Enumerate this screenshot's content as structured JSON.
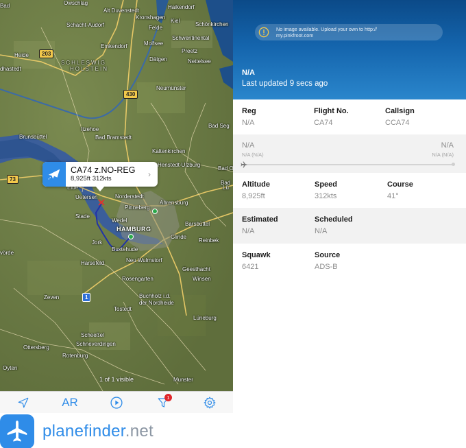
{
  "map": {
    "places": [
      {
        "id": "owschlag",
        "name": "Owschlag"
      },
      {
        "id": "alt-duvenstedt",
        "name": "Alt Duvenstedt"
      },
      {
        "id": "haikendorf",
        "name": "Haikendorf"
      },
      {
        "id": "kronshagen",
        "name": "Kronshagen"
      },
      {
        "id": "schacht-audorf",
        "name": "Schacht-Audorf"
      },
      {
        "id": "felde",
        "name": "Felde"
      },
      {
        "id": "kiel",
        "name": "Kiel"
      },
      {
        "id": "schonkirchen",
        "name": "Schönkirchen"
      },
      {
        "id": "schwentinental",
        "name": "Schwentinental"
      },
      {
        "id": "emkendorf",
        "name": "Emkendorf"
      },
      {
        "id": "molfsee",
        "name": "Molfsee"
      },
      {
        "id": "preetz",
        "name": "Preetz"
      },
      {
        "id": "heide",
        "name": "Heide"
      },
      {
        "id": "dahstedt",
        "name": "dhastedt"
      },
      {
        "id": "datgen",
        "name": "Dätgen"
      },
      {
        "id": "nettelsee",
        "name": "Nettelsee"
      },
      {
        "id": "neumunster",
        "name": "Neumünster"
      },
      {
        "id": "itzehoe",
        "name": "Itzehoe"
      },
      {
        "id": "bad-segeberg",
        "name": "Bad Seg"
      },
      {
        "id": "brunsbuttel",
        "name": "Brunsbüttel"
      },
      {
        "id": "bad-bramstedt",
        "name": "Bad Bramstedt"
      },
      {
        "id": "kaltenkirchen",
        "name": "Kaltenkirchen"
      },
      {
        "id": "henstedt-ulzburg",
        "name": "Henstedt-Ulzburg"
      },
      {
        "id": "bad-o",
        "name": "Bad O"
      },
      {
        "id": "uetersen",
        "name": "Uetersen"
      },
      {
        "id": "norderstedt",
        "name": "Norderstedt"
      },
      {
        "id": "ahrensburg",
        "name": "Ahrensburg"
      },
      {
        "id": "pinneberg",
        "name": "Pinneberg"
      },
      {
        "id": "stade",
        "name": "Stade"
      },
      {
        "id": "wedel",
        "name": "Wedel"
      },
      {
        "id": "hamburg",
        "name": "HAMBURG"
      },
      {
        "id": "barsbuttel",
        "name": "Barsbüttel"
      },
      {
        "id": "glinde",
        "name": "Glinde"
      },
      {
        "id": "reinbek",
        "name": "Reinbek"
      },
      {
        "id": "jork",
        "name": "Jork"
      },
      {
        "id": "buxtehude",
        "name": "Buxtehude"
      },
      {
        "id": "neu-wulmstorf",
        "name": "Neu Wulmstorf"
      },
      {
        "id": "harsefeld",
        "name": "Harsefeld"
      },
      {
        "id": "geesthacht",
        "name": "Geesthacht"
      },
      {
        "id": "rosengarten",
        "name": "Rosengarten"
      },
      {
        "id": "winsen",
        "name": "Winsen"
      },
      {
        "id": "zeven",
        "name": "Zeven"
      },
      {
        "id": "buchholz",
        "name": "Buchholz i.d."
      },
      {
        "id": "buchholz2",
        "name": "der Nordheide"
      },
      {
        "id": "tostedt",
        "name": "Tostedt"
      },
      {
        "id": "luneburg",
        "name": "Lüneburg"
      },
      {
        "id": "scheeßel",
        "name": "Scheeßel"
      },
      {
        "id": "schneverdingen",
        "name": "Schneverdingen"
      },
      {
        "id": "ottersberg",
        "name": "Ottersberg"
      },
      {
        "id": "rotenburg",
        "name": "Rotenburg"
      },
      {
        "id": "oyten",
        "name": "Oyten"
      },
      {
        "id": "munster",
        "name": "Munster"
      },
      {
        "id": "elbe",
        "name": "Elbe"
      },
      {
        "id": "vorde",
        "name": "vörde"
      },
      {
        "id": "bad-left",
        "name": "Bad"
      },
      {
        "id": "bad-right",
        "name": "Bad"
      },
      {
        "id": "lubeck",
        "name": "Lü"
      }
    ],
    "region_line1": "SCHLESWIG",
    "region_line2": "HOLSTEIN",
    "road_shields": [
      "203",
      "430",
      "73",
      "1"
    ],
    "callout": {
      "title": "CA74 z.NO-REG",
      "subtitle": "8,925ft 312kts",
      "chevron": "›"
    },
    "visible_count": "1 of 1 visible"
  },
  "tabbar": {
    "items": [
      {
        "name": "location",
        "icon": "location-arrow-icon"
      },
      {
        "name": "ar",
        "label": "AR"
      },
      {
        "name": "playback",
        "icon": "play-circle-icon"
      },
      {
        "name": "filter",
        "icon": "filter-icon",
        "badge": "1"
      },
      {
        "name": "settings",
        "icon": "gear-icon"
      }
    ],
    "accent": "#2f8ce8"
  },
  "brand": {
    "word1": "planefinder",
    "word2": ".net",
    "logo_icon": "airplane-icon"
  },
  "details": {
    "notice": "No image available. Upload your own to http://\nmy.pinkfroot.com",
    "notice_icon": "info-circle-icon",
    "aircraft": "N/A",
    "updated": "Last updated 9 secs ago",
    "header_color": "#1464ac",
    "row1": {
      "reg_label": "Reg",
      "reg_value": "N/A",
      "flight_label": "Flight No.",
      "flight_value": "CA74",
      "callsign_label": "Callsign",
      "callsign_value": "CCA74"
    },
    "route": {
      "origin": "N/A",
      "origin_sub": "N/A (N/A)",
      "dest": "N/A",
      "dest_sub": "N/A (N/A)"
    },
    "row2": {
      "altitude_label": "Altitude",
      "altitude_value": "8,925ft",
      "speed_label": "Speed",
      "speed_value": "312kts",
      "course_label": "Course",
      "course_value": "41°"
    },
    "row3": {
      "estimated_label": "Estimated",
      "estimated_value": "N/A",
      "scheduled_label": "Scheduled",
      "scheduled_value": "N/A"
    },
    "row4": {
      "squawk_label": "Squawk",
      "squawk_value": "6421",
      "source_label": "Source",
      "source_value": "ADS-B"
    }
  }
}
